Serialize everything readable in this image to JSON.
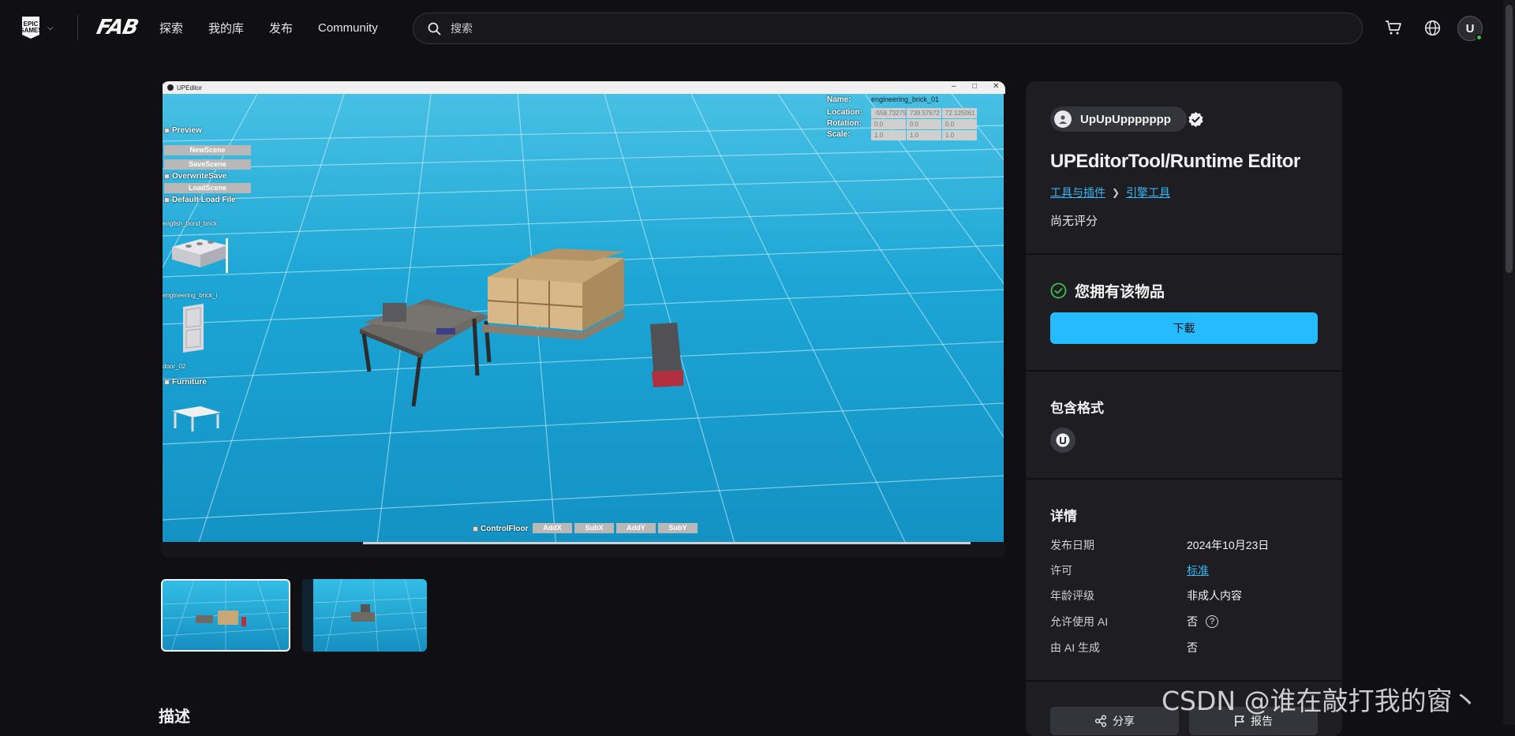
{
  "nav": {
    "epic_logo_text": "EPIC GAMES",
    "fab_logo_text": "FAB",
    "links": [
      "探索",
      "我的库",
      "发布",
      "Community"
    ],
    "search_placeholder": "搜索",
    "avatar_initial": "U"
  },
  "viewer": {
    "window_title": "UPEditor",
    "left_panel": {
      "preview_label": "Preview",
      "new_scene": "NewScene",
      "save_scene": "SaveScene",
      "overwrite_save": "OverwriteSave",
      "load_scene": "LoadScene",
      "default_load_file": "Default Load File",
      "assets": [
        "english_bond_brick",
        "engineering_brick_i",
        "door_02"
      ],
      "furniture_label": "Furniture"
    },
    "properties": {
      "name_label": "Name:",
      "name_value": "engineering_brick_01",
      "location_label": "Location:",
      "location_values": [
        "-558.73275",
        "739.57672",
        "72.125061"
      ],
      "rotation_label": "Rotation:",
      "rotation_values": [
        "0.0",
        "0.0",
        "0.0"
      ],
      "scale_label": "Scale:",
      "scale_values": [
        "1.0",
        "1.0",
        "1.0"
      ]
    },
    "bottom_controls": {
      "control_floor": "ControlFloor",
      "buttons": [
        "AddX",
        "SubX",
        "AddY",
        "SubY"
      ]
    }
  },
  "description_heading": "描述",
  "panel": {
    "seller_name": "UpUpUppppppp",
    "product_title": "UPEditorTool/Runtime Editor",
    "breadcrumb": [
      "工具与插件",
      "引擎工具"
    ],
    "rating_text": "尚无评分",
    "owned_text": "您拥有该物品",
    "download_label": "下載",
    "formats_heading": "包含格式",
    "details_heading": "详情",
    "details": [
      {
        "label": "发布日期",
        "value": "2024年10月23日"
      },
      {
        "label": "许可",
        "value": "标准"
      },
      {
        "label": "年龄评级",
        "value": "非成人内容"
      },
      {
        "label": "允许使用 AI",
        "value": "否"
      },
      {
        "label": "由 AI 生成",
        "value": "否"
      }
    ],
    "share_label": "分享",
    "report_label": "报告"
  },
  "watermark": "CSDN @谁在敲打我的窗丶",
  "colors": {
    "background": "#101014",
    "panel": "#1d1d22",
    "accent_blue": "#26bbff",
    "link_blue": "#38b6f5",
    "scene_blue": "#1ba4d4",
    "owned_green": "#3fbf4a"
  }
}
